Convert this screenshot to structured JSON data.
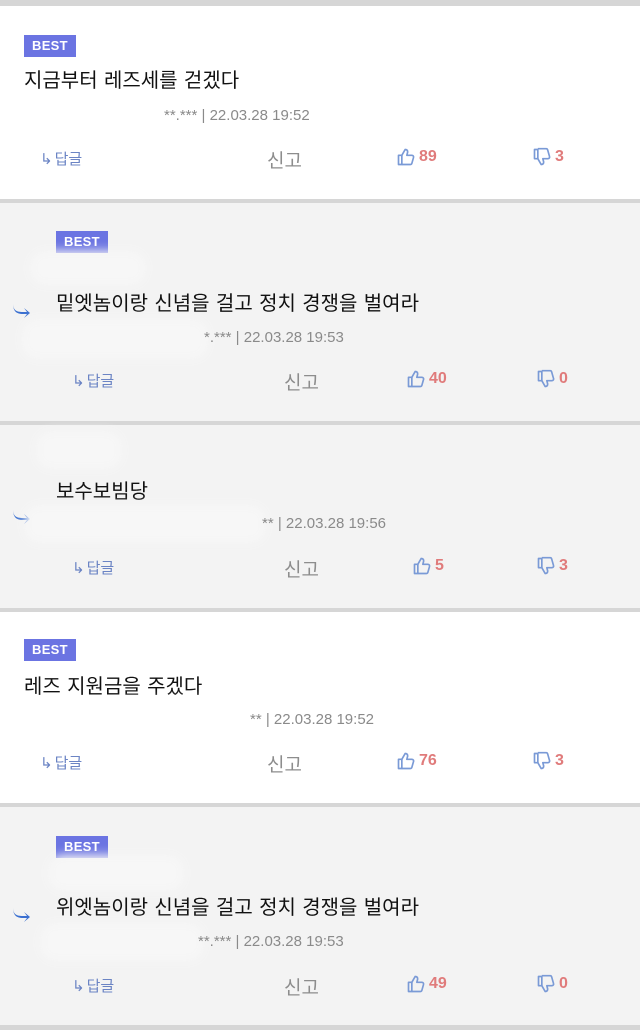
{
  "labels": {
    "best": "BEST",
    "reply": "답글",
    "report": "신고"
  },
  "colors": {
    "badge": "#6b74e2",
    "vote_count": "#e07b7b",
    "icon": "#7a9ad6"
  },
  "comments": [
    {
      "best": true,
      "text": "지금부터 레즈세를 걷겠다",
      "meta": "**.*** | 22.03.28 19:52",
      "likes": "89",
      "dislikes": "3"
    },
    {
      "best": true,
      "text": "밑엣놈이랑 신념을 걸고 정치 경쟁을 벌여라",
      "meta": "*.*** | 22.03.28 19:53",
      "likes": "40",
      "dislikes": "0"
    },
    {
      "best": false,
      "text": "보수보빔당",
      "meta": "** | 22.03.28 19:56",
      "likes": "5",
      "dislikes": "3"
    },
    {
      "best": true,
      "text": "레즈 지원금을 주겠다",
      "meta": "** | 22.03.28 19:52",
      "likes": "76",
      "dislikes": "3"
    },
    {
      "best": true,
      "text": "위엣놈이랑 신념을 걸고 정치 경쟁을 벌여라",
      "meta": "**.*** | 22.03.28 19:53",
      "likes": "49",
      "dislikes": "0"
    }
  ]
}
